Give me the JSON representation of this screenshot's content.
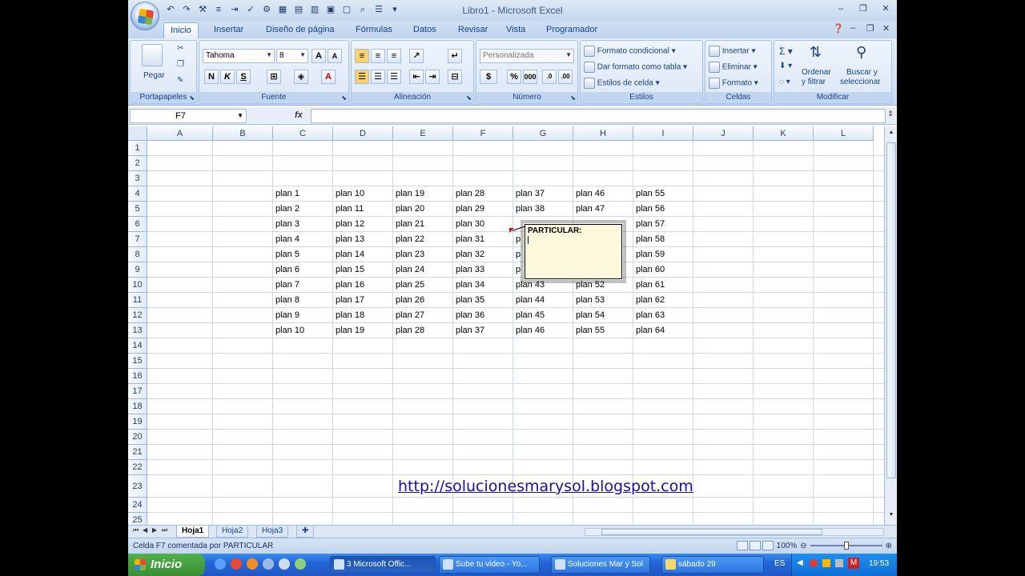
{
  "window": {
    "title": "Libro1 - Microsoft Excel",
    "controls": {
      "minimize": "–",
      "restore": "❐",
      "close": "✕"
    },
    "workbook_controls": {
      "minimize": "–",
      "restore": "❐",
      "close": "✕"
    }
  },
  "ribbon_tabs": [
    "Inicio",
    "Insertar",
    "Diseño de página",
    "Fórmulas",
    "Datos",
    "Revisar",
    "Vista",
    "Programador"
  ],
  "ribbon": {
    "portapapeles": {
      "label": "Portapapeles",
      "paste": "Pegar"
    },
    "fuente": {
      "label": "Fuente",
      "font": "Tahoma",
      "size": "8",
      "bold": "N",
      "italic": "K",
      "underline": "S"
    },
    "alineacion": {
      "label": "Alineación"
    },
    "numero": {
      "label": "Número",
      "format": "Personalizada"
    },
    "estilos": {
      "label": "Estilos",
      "conditional": "Formato condicional",
      "as_table": "Dar formato como tabla",
      "cell_styles": "Estilos de celda"
    },
    "celdas": {
      "label": "Celdas",
      "insert": "Insertar",
      "delete": "Eliminar",
      "format": "Formato"
    },
    "modificar": {
      "label": "Modificar",
      "sort": "Ordenar",
      "sort2": "y filtrar",
      "find": "Buscar y",
      "find2": "seleccionar"
    }
  },
  "formula_bar": {
    "name_box": "F7",
    "fx": "fx",
    "value": ""
  },
  "columns": [
    "A",
    "B",
    "C",
    "D",
    "E",
    "F",
    "G",
    "H",
    "I",
    "J",
    "K",
    "L"
  ],
  "rows": [
    "1",
    "2",
    "3",
    "4",
    "5",
    "6",
    "7",
    "8",
    "9",
    "10",
    "11",
    "12",
    "13",
    "14",
    "15",
    "16",
    "17",
    "18",
    "19",
    "20",
    "21",
    "22",
    "23",
    "24",
    "25"
  ],
  "cells": {
    "C": [
      "plan 1",
      "plan 2",
      "plan 3",
      "plan 4",
      "plan 5",
      "plan 6",
      "plan 7",
      "plan 8",
      "plan 9",
      "plan 10"
    ],
    "D": [
      "plan 10",
      "plan 11",
      "plan 12",
      "plan 13",
      "plan 14",
      "plan 15",
      "plan 16",
      "plan 17",
      "plan 18",
      "plan 19"
    ],
    "E": [
      "plan 19",
      "plan 20",
      "plan 21",
      "plan 22",
      "plan 23",
      "plan 24",
      "plan 25",
      "plan 26",
      "plan 27",
      "plan 28"
    ],
    "F": [
      "plan 28",
      "plan 29",
      "plan 30",
      "plan 31",
      "plan 32",
      "plan 33",
      "plan 34",
      "plan 35",
      "plan 36",
      "plan 37"
    ],
    "G": [
      "plan 37",
      "plan 38",
      "",
      "p",
      "p",
      "p",
      "plan 43",
      "plan 44",
      "plan 45",
      "plan 46"
    ],
    "H": [
      "plan 46",
      "plan 47",
      "",
      "",
      "",
      "",
      "plan 52",
      "plan 53",
      "plan 54",
      "plan 55"
    ],
    "I": [
      "plan 55",
      "plan 56",
      "plan 57",
      "plan 58",
      "plan 59",
      "plan 60",
      "plan 61",
      "plan 62",
      "plan 63",
      "plan 64"
    ]
  },
  "comment": {
    "author": "PARTICULAR:"
  },
  "link_text": "http://solucionesmarysol.blogspot.com",
  "sheets": [
    "Hoja1",
    "Hoja2",
    "Hoja3"
  ],
  "status": {
    "text": "Celda F7 comentada por PARTICULAR",
    "zoom": "100%"
  },
  "taskbar": {
    "start": "Inicio",
    "buttons": [
      "3 Microsoft Offic...",
      "Sube tu video - Yo...",
      "Soluciones Mar y Sol",
      "sábado 29"
    ],
    "lang": "ES",
    "clock": "19:53"
  },
  "colors": {
    "ribbon": "#dbe7f6",
    "accent": "#15428b",
    "link": "#1a0dab",
    "comment_bg": "#fbf8dc",
    "taskbar": "#2466d6",
    "start": "#3a8f33"
  }
}
